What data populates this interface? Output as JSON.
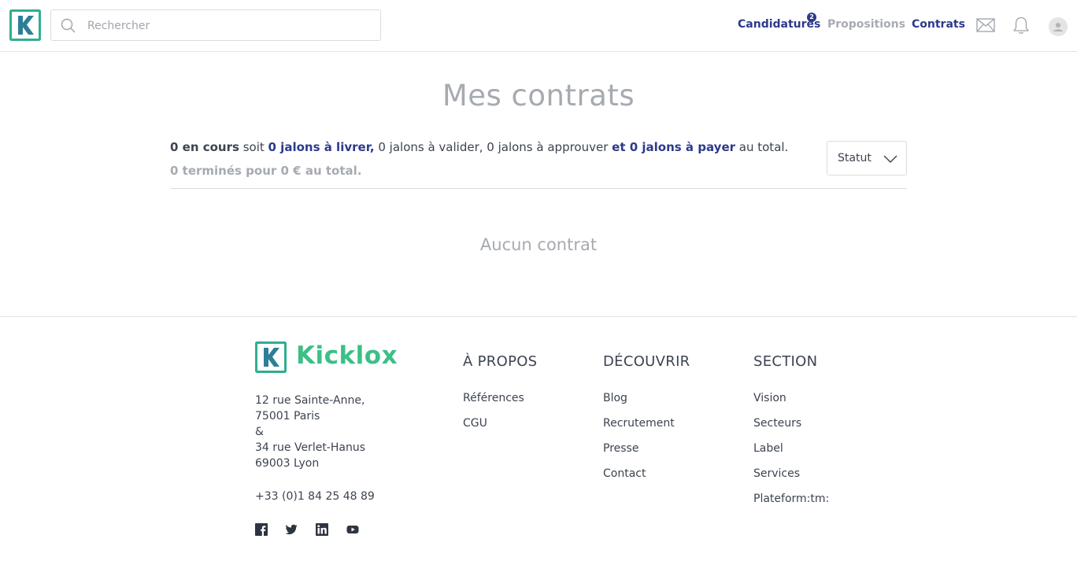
{
  "header": {
    "search_placeholder": "Rechercher",
    "nav": {
      "candidatures": "Candidatures",
      "candidatures_badge": "2",
      "propositions": "Propositions",
      "contrats": "Contrats"
    },
    "icons": [
      "search-icon",
      "mail-icon",
      "bell-icon",
      "avatar"
    ]
  },
  "main": {
    "title": "Mes contrats",
    "summary": {
      "in_progress": "0 en cours",
      "soit": " soit ",
      "to_deliver": "0 jalons à livrer,",
      "middle": " 0 jalons à valider, 0 jalons à approuver ",
      "to_pay": "et 0 jalons à payer",
      "end": " au total."
    },
    "finished": "0 terminés pour 0 € au total.",
    "status_filter": "Statut",
    "empty_state": "Aucun contrat"
  },
  "footer": {
    "brand": "Kicklox",
    "address_lines": [
      "12 rue Sainte-Anne,",
      "75001 Paris",
      "&",
      "34 rue Verlet-Hanus",
      "69003 Lyon"
    ],
    "phone": "+33 (0)1 84 25 48 89",
    "social_icons": [
      "facebook-icon",
      "twitter-icon",
      "linkedin-icon",
      "youtube-icon"
    ],
    "columns": [
      {
        "title": "À PROPOS",
        "links": [
          "Références",
          "CGU"
        ]
      },
      {
        "title": "DÉCOUVRIR",
        "links": [
          "Blog",
          "Recrutement",
          "Presse",
          "Contact"
        ]
      },
      {
        "title": "SECTION",
        "links": [
          "Vision",
          "Secteurs",
          "Label",
          "Services",
          "Plateform:tm:"
        ]
      }
    ]
  },
  "colors": {
    "brand_green": "#3dbf86",
    "brand_blue": "#2d3a8c",
    "muted_gray": "#a6aab1"
  }
}
